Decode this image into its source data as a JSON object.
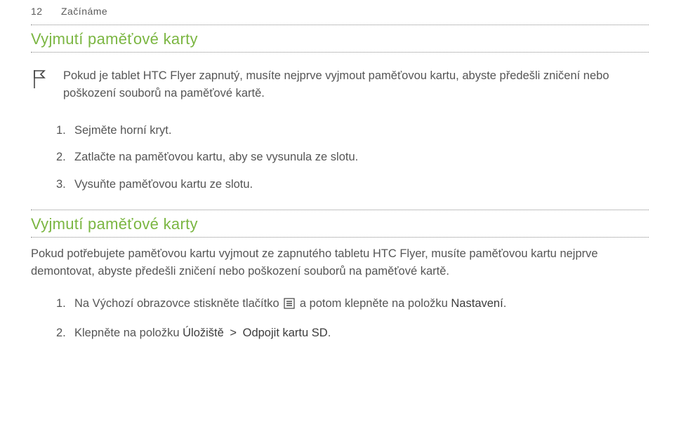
{
  "header": {
    "page_number": "12",
    "section_name": "Začínáme"
  },
  "section1": {
    "title": "Vyjmutí paměťové karty",
    "callout": "Pokud je tablet HTC Flyer zapnutý, musíte nejprve vyjmout paměťovou kartu, abyste předešli zničení nebo poškození souborů na paměťové kartě.",
    "steps": [
      {
        "num": "1.",
        "text": "Sejměte horní kryt."
      },
      {
        "num": "2.",
        "text": "Zatlačte na paměťovou kartu, aby se vysunula ze slotu."
      },
      {
        "num": "3.",
        "text": "Vysuňte paměťovou kartu ze slotu."
      }
    ]
  },
  "section2": {
    "title": "Vyjmutí paměťové karty",
    "intro": "Pokud potřebujete paměťovou kartu vyjmout ze zapnutého tabletu HTC Flyer, musíte paměťovou kartu nejprve demontovat, abyste předešli zničení nebo poškození souborů na paměťové kartě.",
    "steps": [
      {
        "num": "1.",
        "pre": "Na Výchozí obrazovce stiskněte tlačítko ",
        "post": " a potom klepněte na položku ",
        "bold": "Nastavení",
        "tail": "."
      },
      {
        "num": "2.",
        "pre": "Klepněte na položku ",
        "b1": "Úložiště",
        "sep": " > ",
        "b2": "Odpojit kartu SD",
        "tail": "."
      }
    ]
  },
  "icons": {
    "flag": "flag-icon",
    "menu": "menu-icon"
  }
}
